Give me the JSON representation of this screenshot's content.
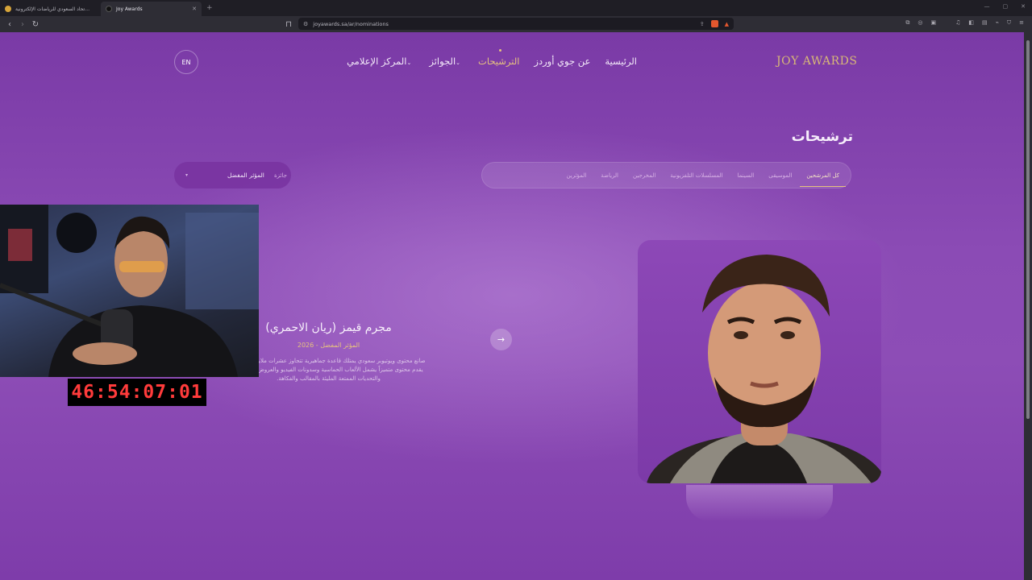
{
  "browser": {
    "tabs": [
      {
        "title": "جوائز الاتحاد السعودي للرياضات الإلكترونية",
        "active": false,
        "favicon_color": "#d7a53a"
      },
      {
        "title": "Joy Awards",
        "active": true,
        "favicon_color": "#111111"
      }
    ],
    "url": "joyawards.sa/ar/nominations"
  },
  "site": {
    "logo": "JOY AWARDS",
    "nav": [
      {
        "label": "الرئيسية",
        "active": false,
        "has_caret": false
      },
      {
        "label": "عن جوي أوردز",
        "active": false,
        "has_caret": false
      },
      {
        "label": "الترشيحات",
        "active": true,
        "has_caret": false
      },
      {
        "label": "الجوائز",
        "active": false,
        "has_caret": true
      },
      {
        "label": "المركز الإعلامي",
        "active": false,
        "has_caret": true
      }
    ],
    "lang_toggle": "EN"
  },
  "nominations": {
    "title": "ترشيحات",
    "category_tabs": [
      {
        "label": "كل المرشحين",
        "active": true
      },
      {
        "label": "الموسيقى",
        "active": false
      },
      {
        "label": "السينما",
        "active": false
      },
      {
        "label": "المسلسلات التلفزيونية",
        "active": false
      },
      {
        "label": "المخرجين",
        "active": false
      },
      {
        "label": "الرياضة",
        "active": false
      },
      {
        "label": "المؤثرين",
        "active": false
      }
    ],
    "category_select": {
      "label": "جائزة",
      "value": "المؤثر المفضل"
    },
    "nominee": {
      "name": "مجرم قيمز (ريان الاحمري)",
      "category_year": "المؤثر المفضل - 2026",
      "description": "صانع محتوى ويوتيوبر سعودي يمتلك قاعدة جماهيرية تتجاوز عشرات ملايين مشترك. يقدم محتوى متميزاً يشمل الألعاب الحماسية وسدونات الفيديو والعروض الكوميدية والتحديات الممتعة المليئة بالمقالب والفكاهة."
    }
  },
  "overlay": {
    "timer": "46:54:07:01"
  },
  "colors": {
    "accent_gold": "#e6c27f",
    "page_purple": "#8b4bb5",
    "timer_red": "#ff3b3b"
  }
}
